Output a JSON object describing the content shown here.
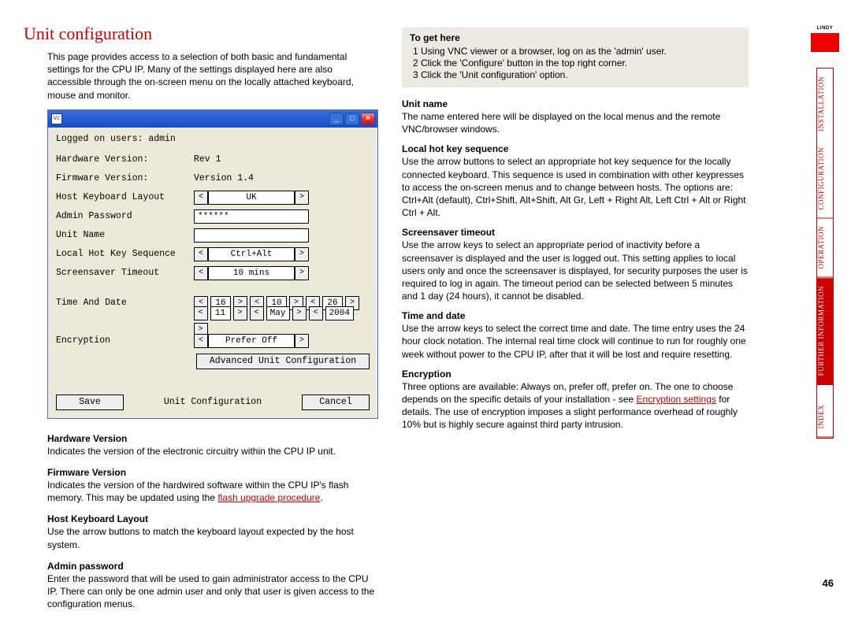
{
  "page": {
    "number": "46",
    "logo_text": "LINDY"
  },
  "heading": "Unit configuration",
  "intro": "This page provides access to a selection of both basic and fundamental settings for the CPU IP. Many of the settings displayed here are also accessible through the on-screen menu on the locally attached keyboard, mouse and monitor.",
  "window": {
    "icon": "Vc",
    "status": "Logged on users: admin",
    "rows": {
      "hw_label": "Hardware Version:",
      "hw_value": "Rev 1",
      "fw_label": "Firmware Version:",
      "fw_value": "Version 1.4",
      "kbd_label": "Host Keyboard Layout",
      "kbd_value": "UK",
      "pwd_label": "Admin Password",
      "pwd_value": "******",
      "name_label": "Unit Name",
      "hotkey_label": "Local Hot Key Sequence",
      "hotkey_value": "Ctrl+Alt",
      "ss_label": "Screensaver Timeout",
      "ss_value": "10 mins",
      "td_label": "Time And Date",
      "td_hour": "16",
      "td_min": "10",
      "td_sec": "26",
      "td_day": "11",
      "td_month": "May",
      "td_year": "2004",
      "enc_label": "Encryption",
      "enc_value": "Prefer Off"
    },
    "advanced_btn": "Advanced Unit Configuration",
    "save_btn": "Save",
    "center_title": "Unit Configuration",
    "cancel_btn": "Cancel"
  },
  "left_sections": {
    "hw_h": "Hardware Version",
    "hw_p": "Indicates the version of the electronic circuitry within the CPU IP unit.",
    "fw_h": "Firmware Version",
    "fw_p1": "Indicates the version of the hardwired software within the CPU IP's flash memory. This may be updated using the ",
    "fw_link": "flash upgrade procedure",
    "fw_p2": ".",
    "kbd_h": "Host Keyboard Layout",
    "kbd_p": "Use the arrow buttons to match the keyboard layout expected by the host system.",
    "pwd_h": "Admin password",
    "pwd_p": "Enter the password that will be used to gain administrator access to the CPU IP. There can only be one admin user and only that user is given access to the configuration menus."
  },
  "getbox": {
    "title": "To get here",
    "s1": "1  Using VNC viewer or a browser, log on as the 'admin' user.",
    "s2": "2  Click the 'Configure' button in the top right corner.",
    "s3": "3  Click the 'Unit configuration' option."
  },
  "right_sections": {
    "name_h": "Unit name",
    "name_p": "The name entered here will be displayed on the local menus and the remote VNC/browser windows.",
    "hk_h": "Local hot key sequence",
    "hk_p": "Use the arrow buttons to select an appropriate hot key sequence for the locally connected keyboard. This sequence is used in combination with other keypresses to access the on-screen menus and to change between hosts. The options are: Ctrl+Alt (default), Ctrl+Shift, Alt+Shift, Alt Gr, Left + Right Alt, Left Ctrl + Alt or Right Ctrl + Alt.",
    "ss_h": "Screensaver timeout",
    "ss_p": "Use the arrow keys to select an appropriate period of inactivity before a screensaver is displayed and the user is logged out. This setting applies to local users only and once the screensaver is displayed, for security purposes the user is required to log in again. The timeout period can be selected between 5 minutes and 1 day (24 hours), it cannot be disabled.",
    "td_h": "Time and date",
    "td_p": "Use the arrow keys to select the correct time and date. The time entry uses the 24 hour clock notation. The internal real time clock will continue to run for roughly one week without power to the CPU IP, after that it will be lost and require resetting.",
    "enc_h": "Encryption",
    "enc_p1": "Three options are available: Always on, prefer off, prefer on. The one to choose depends on the specific details of your installation - see ",
    "enc_link": "Encryption settings",
    "enc_p2": " for details. The use of encryption imposes a slight performance overhead of roughly 10% but is highly secure against third party intrusion."
  },
  "nav": {
    "install": "INSTALLATION",
    "config": "CONFIGURATION",
    "operation": "OPERATION",
    "further": "FURTHER INFORMATION",
    "index": "INDEX"
  }
}
